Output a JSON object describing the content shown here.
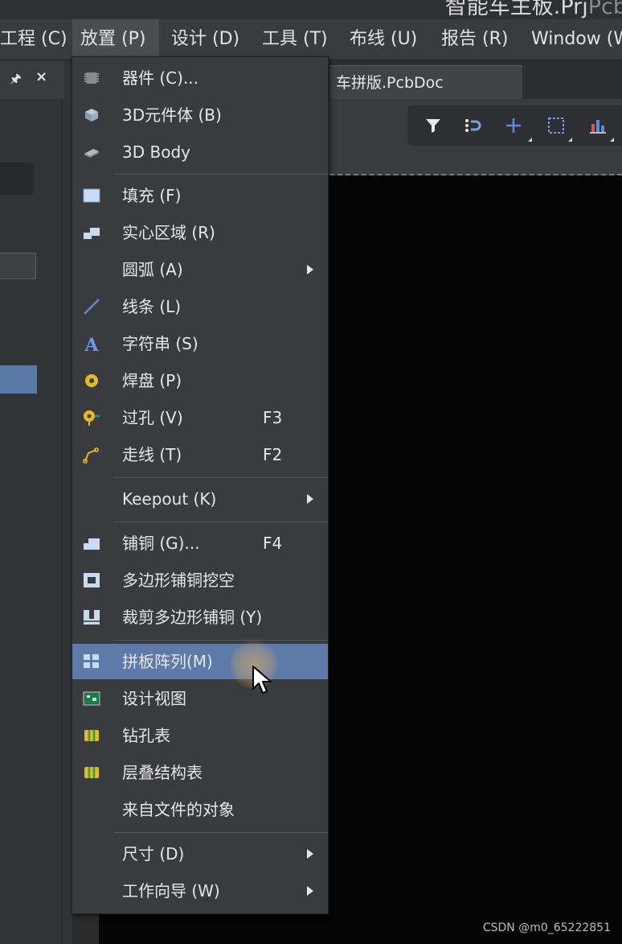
{
  "window": {
    "title_main": "智能车主板.Prj",
    "title_faded": "Pcb"
  },
  "menubar": {
    "items": [
      {
        "label": "工程 (C)"
      },
      {
        "label": "放置 (P)"
      },
      {
        "label": "设计 (D)"
      },
      {
        "label": "工具 (T)"
      },
      {
        "label": "布线 (U)"
      },
      {
        "label": "报告 (R)"
      },
      {
        "label": "Window (W)"
      }
    ],
    "active_index": 1
  },
  "panel": {
    "pin_glyph": "🖈",
    "close_glyph": "×"
  },
  "document": {
    "tab_label": "车拼版.PcbDoc"
  },
  "toolbar": {
    "tools": [
      "filter-icon",
      "route-magnet-icon",
      "plus-icon",
      "select-rect-icon",
      "chart-icon"
    ]
  },
  "place_menu": {
    "items": [
      {
        "label": "器件 (C)...",
        "shortcut": "",
        "submenu": false,
        "icon": "component-icon"
      },
      {
        "label": "3D元件体 (B)",
        "shortcut": "",
        "submenu": false,
        "icon": "3d-body-icon"
      },
      {
        "label": "3D Body",
        "shortcut": "",
        "submenu": false,
        "icon": "chip-3d-icon"
      },
      {
        "label": "填充 (F)",
        "shortcut": "",
        "submenu": false,
        "icon": "fill-icon"
      },
      {
        "label": "实心区域 (R)",
        "shortcut": "",
        "submenu": false,
        "icon": "solid-region-icon"
      },
      {
        "label": "圆弧 (A)",
        "shortcut": "",
        "submenu": true,
        "icon": ""
      },
      {
        "label": "线条 (L)",
        "shortcut": "",
        "submenu": false,
        "icon": "line-icon"
      },
      {
        "label": "字符串 (S)",
        "shortcut": "",
        "submenu": false,
        "icon": "string-icon"
      },
      {
        "label": "焊盘 (P)",
        "shortcut": "",
        "submenu": false,
        "icon": "pad-icon"
      },
      {
        "label": "过孔 (V)",
        "shortcut": "F3",
        "submenu": false,
        "icon": "via-icon"
      },
      {
        "label": "走线 (T)",
        "shortcut": "F2",
        "submenu": false,
        "icon": "track-icon"
      },
      {
        "label": "Keepout (K)",
        "shortcut": "",
        "submenu": true,
        "icon": ""
      },
      {
        "label": "铺铜 (G)...",
        "shortcut": "F4",
        "submenu": false,
        "icon": "polygon-pour-icon"
      },
      {
        "label": "多边形铺铜挖空",
        "shortcut": "",
        "submenu": false,
        "icon": "polygon-cutout-icon"
      },
      {
        "label": "裁剪多边形铺铜 (Y)",
        "shortcut": "",
        "submenu": false,
        "icon": "slice-polygon-icon"
      },
      {
        "label": "拼板阵列(M)",
        "shortcut": "",
        "submenu": false,
        "icon": "embedded-board-array-icon"
      },
      {
        "label": "设计视图",
        "shortcut": "",
        "submenu": false,
        "icon": "design-view-icon"
      },
      {
        "label": "钻孔表",
        "shortcut": "",
        "submenu": false,
        "icon": "drill-table-icon"
      },
      {
        "label": "层叠结构表",
        "shortcut": "",
        "submenu": false,
        "icon": "layer-stack-table-icon"
      },
      {
        "label": "来自文件的对象",
        "shortcut": "",
        "submenu": false,
        "icon": ""
      },
      {
        "label": "尺寸 (D)",
        "shortcut": "",
        "submenu": true,
        "icon": ""
      },
      {
        "label": "工作向导 (W)",
        "shortcut": "",
        "submenu": true,
        "icon": ""
      }
    ],
    "highlighted_index": 15
  },
  "watermark": "CSDN @m0_65222851",
  "colors": {
    "menu_bg": "#3a3b3e",
    "highlight": "#5d7aa8",
    "canvas": "#050505"
  }
}
